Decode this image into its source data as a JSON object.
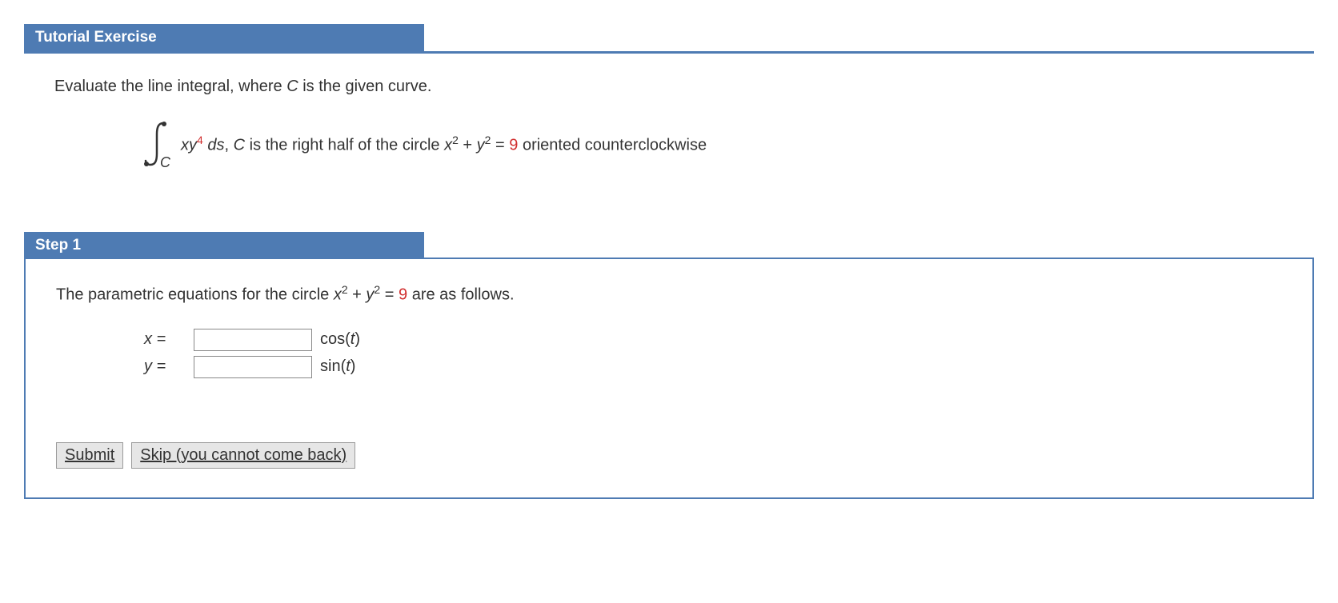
{
  "headers": {
    "tutorial": "Tutorial Exercise",
    "step1": "Step 1"
  },
  "problem": {
    "intro": "Evaluate the line integral, where ",
    "C": "C",
    "intro2": " is the given curve.",
    "integral_sub": "C",
    "integrand_xy": "xy",
    "integrand_exp": "4",
    "ds": " ds",
    "comma": ", ",
    "C2": "C",
    "desc1": "  is the right half of the circle ",
    "x": "x",
    "exp2a": "2",
    "plus": " + ",
    "y": "y",
    "exp2b": "2",
    "eq": " = ",
    "nine": "9",
    "desc2": " oriented counterclockwise"
  },
  "step1": {
    "line1a": "The parametric equations for the circle  ",
    "x": "x",
    "exp2a": "2",
    "plus": " + ",
    "y": "y",
    "exp2b": "2",
    "eq": " = ",
    "nine": "9",
    "line1b": "  are as follows.",
    "xlabel": "x =",
    "ylabel": "y =",
    "x_value": "",
    "y_value": "",
    "cos": "cos(",
    "sin": "sin(",
    "t": "t",
    "close": ")"
  },
  "buttons": {
    "submit": "Submit",
    "skip": "Skip (you cannot come back)"
  }
}
